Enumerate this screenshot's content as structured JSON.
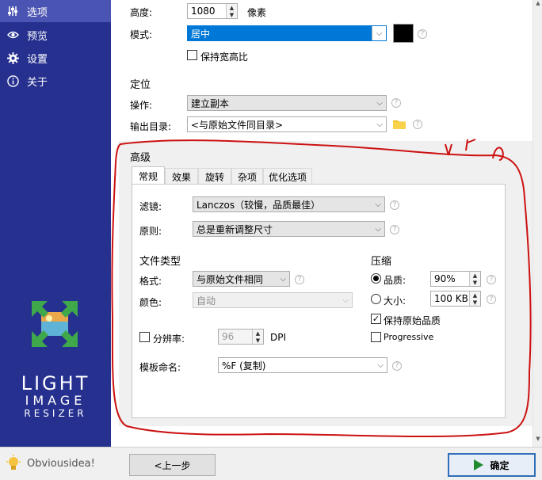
{
  "sidebar": {
    "items": [
      {
        "label": "选项",
        "icon": "sliders-icon",
        "active": true
      },
      {
        "label": "预览",
        "icon": "eye-icon",
        "active": false
      },
      {
        "label": "设置",
        "icon": "gear-icon",
        "active": false
      },
      {
        "label": "关于",
        "icon": "info-icon",
        "active": false
      }
    ],
    "logo": {
      "line1": "LIGHT",
      "line2": "IMAGE",
      "line3": "RESIZER"
    }
  },
  "resize": {
    "height_label": "高度:",
    "height_value": "1080",
    "height_unit": "像素",
    "mode_label": "模式:",
    "mode_value": "居中",
    "mode_color": "#000000",
    "keep_ratio_label": "保持宽高比",
    "keep_ratio_checked": false
  },
  "position": {
    "title": "定位",
    "action_label": "操作:",
    "action_value": "建立副本",
    "output_label": "输出目录:",
    "output_value": "<与原始文件同目录>"
  },
  "advanced": {
    "title": "高级",
    "tabs": [
      "常规",
      "效果",
      "旋转",
      "杂项",
      "优化选项"
    ],
    "active_tab": 0,
    "filter_label": "滤镜:",
    "filter_value": "Lanczos（较慢，品质最佳）",
    "rule_label": "原则:",
    "rule_value": "总是重新调整尺寸",
    "filetype_title": "文件类型",
    "format_label": "格式:",
    "format_value": "与原始文件相同",
    "color_label": "颜色:",
    "color_value": "自动",
    "resolution_label": "分辨率:",
    "resolution_value": "96",
    "resolution_unit": "DPI",
    "resolution_checked": false,
    "template_label": "模板命名:",
    "template_value": "%F (复制)",
    "compress_title": "压缩",
    "quality_label": "品质:",
    "quality_value": "90%",
    "size_label": "大小:",
    "size_value": "100 KB",
    "quality_selected": true,
    "keep_quality_label": "保持原始品质",
    "keep_quality_checked": true,
    "progressive_label": "Progressive",
    "progressive_checked": false
  },
  "footer": {
    "brand": "Obviousidea!",
    "prev_label": "<上一步",
    "ok_label": "确定"
  },
  "colors": {
    "sidebar_bg": "#26308f",
    "sidebar_active": "#4a54b2",
    "mode_highlight": "#0078d7",
    "annotation": "#cc1111",
    "ok_icon": "#1e8b2e"
  }
}
